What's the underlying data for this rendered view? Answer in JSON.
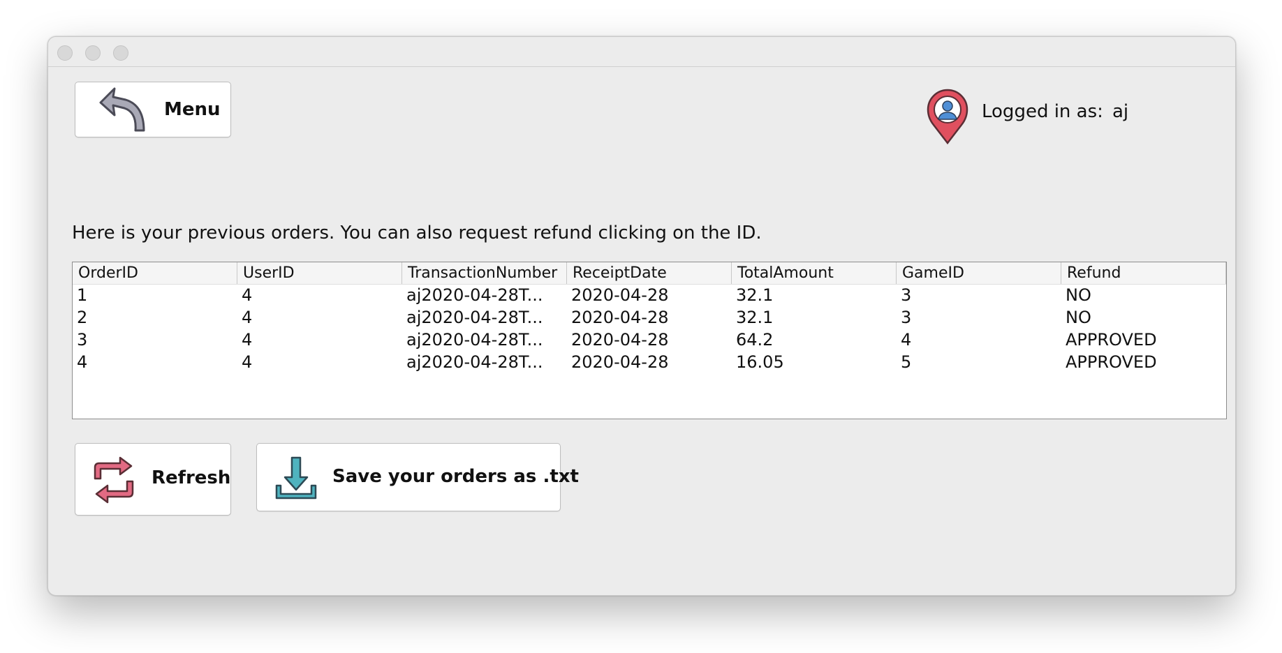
{
  "header": {
    "menu_button_label": "Menu",
    "logged_in_label": "Logged in as:",
    "username": "aj",
    "user_icon": "user-location-pin-icon",
    "menu_icon": "back-arrow-icon"
  },
  "main": {
    "instructions": "Here is your previous orders. You can also request refund clicking on the ID.",
    "orders_table": {
      "columns": [
        "OrderID",
        "UserID",
        "TransactionNumber",
        "ReceiptDate",
        "TotalAmount",
        "GameID",
        "Refund"
      ],
      "rows": [
        [
          "1",
          "4",
          "aj2020-04-28T...",
          "2020-04-28",
          "32.1",
          "3",
          "NO"
        ],
        [
          "2",
          "4",
          "aj2020-04-28T...",
          "2020-04-28",
          "32.1",
          "3",
          "NO"
        ],
        [
          "3",
          "4",
          "aj2020-04-28T...",
          "2020-04-28",
          "64.2",
          "4",
          "APPROVED"
        ],
        [
          "4",
          "4",
          "aj2020-04-28T...",
          "2020-04-28",
          "16.05",
          "5",
          "APPROVED"
        ]
      ]
    }
  },
  "actions": {
    "refresh_label": "Refresh",
    "refresh_icon": "refresh-arrows-icon",
    "save_label": "Save your orders as .txt",
    "save_icon": "download-icon"
  },
  "colors": {
    "window_bg": "#ececec",
    "pin_red": "#e0505f",
    "user_blue": "#4f8fd6",
    "refresh_pink": "#e26a83",
    "download_teal": "#4fb3bf",
    "arrow_gray": "#9a9aa6"
  }
}
